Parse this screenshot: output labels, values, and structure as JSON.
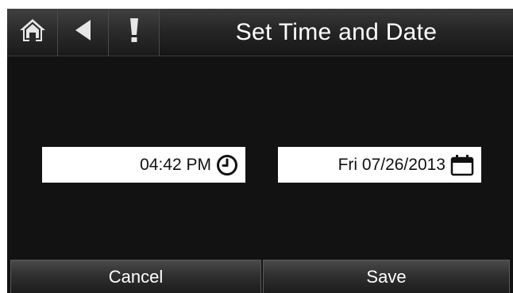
{
  "header": {
    "title": "Set Time and Date",
    "buttons": [
      {
        "name": "home",
        "icon": "home-icon"
      },
      {
        "name": "back",
        "icon": "back-arrow-icon"
      },
      {
        "name": "alert",
        "icon": "exclamation-icon"
      }
    ]
  },
  "fields": {
    "time": {
      "value": "04:42 PM",
      "icon": "clock-icon"
    },
    "date": {
      "value": "Fri 07/26/2013",
      "icon": "calendar-icon"
    }
  },
  "footer": {
    "cancel_label": "Cancel",
    "save_label": "Save"
  },
  "colors": {
    "background": "#121212",
    "header": "#262626",
    "field_bg": "#ffffff",
    "text_light": "#ffffff",
    "text_dark": "#111111"
  }
}
